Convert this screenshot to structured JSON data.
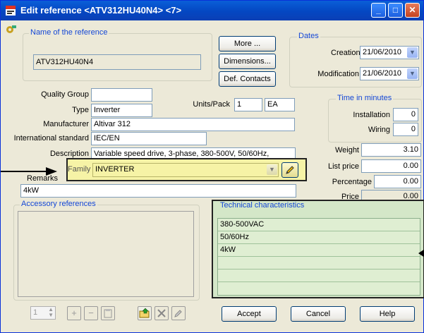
{
  "window": {
    "title": "Edit reference <ATV312HU40N4> <7>",
    "minimize": "_",
    "maximize": "□",
    "close": "✕"
  },
  "reference": {
    "group_label": "Name of the reference",
    "name": "ATV312HU40N4"
  },
  "buttons": {
    "more": "More ...",
    "dimensions": "Dimensions...",
    "def_contacts": "Def. Contacts",
    "accept": "Accept",
    "cancel": "Cancel",
    "help": "Help"
  },
  "dates": {
    "group_label": "Dates",
    "creation_label": "Creation",
    "creation": "21/06/2010",
    "modification_label": "Modification",
    "modification": "21/06/2010"
  },
  "fields": {
    "quality_group_label": "Quality Group",
    "quality_group": "",
    "type_label": "Type",
    "type": "Inverter",
    "units_pack_label": "Units/Pack",
    "units_pack": "1",
    "units_pack_unit": "EA",
    "manufacturer_label": "Manufacturer",
    "manufacturer": "Altivar 312",
    "intl_standard_label": "International standard",
    "intl_standard": "IEC/EN",
    "description_label": "Description",
    "description": "Variable speed drive, 3-phase, 380-500V, 50/60Hz,",
    "family_label": "Family",
    "family": "INVERTER",
    "remarks_label": "Remarks",
    "remarks": "4kW"
  },
  "time": {
    "group_label": "Time in minutes",
    "installation_label": "Installation",
    "installation": "0",
    "wiring_label": "Wiring",
    "wiring": "0"
  },
  "pricing": {
    "weight_label": "Weight",
    "weight": "3.10",
    "list_price_label": "List price",
    "list_price": "0.00",
    "percentage_label": "Percentage",
    "percentage": "0.00",
    "price_label": "Price",
    "price": "0.00"
  },
  "accessory": {
    "group_label": "Accessory references",
    "spin_value": "1"
  },
  "technical": {
    "group_label": "Technical characteristics",
    "rows": [
      "380-500VAC",
      "50/60Hz",
      "4kW",
      "",
      ""
    ]
  }
}
